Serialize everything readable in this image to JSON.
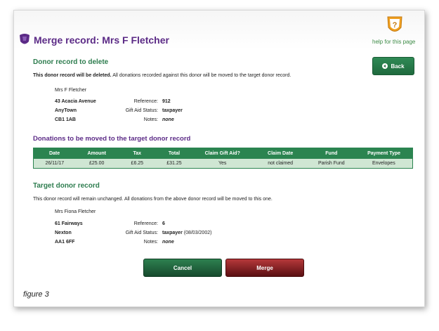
{
  "header": {
    "title": "Merge record: Mrs F Fletcher",
    "help_label": "help for this page"
  },
  "delete_section": {
    "heading": "Donor record to delete",
    "intro_bold": "This donor record will be deleted.",
    "intro_rest": " All donations recorded against this donor will be moved to the target donor record.",
    "name": "Mrs F Fletcher",
    "address": [
      "43 Acacia Avenue",
      "AnyTown",
      "CB1 1AB"
    ],
    "reference_label": "Reference:",
    "reference": "912",
    "gift_aid_label": "Gift Aid Status:",
    "gift_aid": "taxpayer",
    "notes_label": "Notes:",
    "notes": "none"
  },
  "back_button": {
    "label": "Back"
  },
  "donations_section": {
    "heading": "Donations to be moved to the target donor record",
    "columns": [
      "Date",
      "Amount",
      "Tax",
      "Total",
      "Claim Gift Aid?",
      "Claim Date",
      "Fund",
      "Payment Type"
    ],
    "rows": [
      [
        "26/11/17",
        "£25.00",
        "£6.25",
        "£31.25",
        "Yes",
        "not claimed",
        "Parish Fund",
        "Envelopes"
      ]
    ]
  },
  "target_section": {
    "heading": "Target donor record",
    "intro": "This donor record will remain unchanged. All donations from the above donor record will be moved to this one.",
    "name": "Mrs Fiona Fletcher",
    "address": [
      "61 Fairways",
      "Nexton",
      "AA1 6FF"
    ],
    "reference_label": "Reference:",
    "reference": "6",
    "gift_aid_label": "Gift Aid Status:",
    "gift_aid": "taxpayer",
    "gift_aid_date": " (08/03/2002)",
    "notes_label": "Notes:",
    "notes": "none"
  },
  "actions": {
    "cancel_label": "Cancel",
    "merge_label": "Merge"
  },
  "caption": "figure 3",
  "colors": {
    "brand_purple": "#5b2a86",
    "green": "#2e7d4f",
    "merge_red": "#8b1a1d"
  }
}
